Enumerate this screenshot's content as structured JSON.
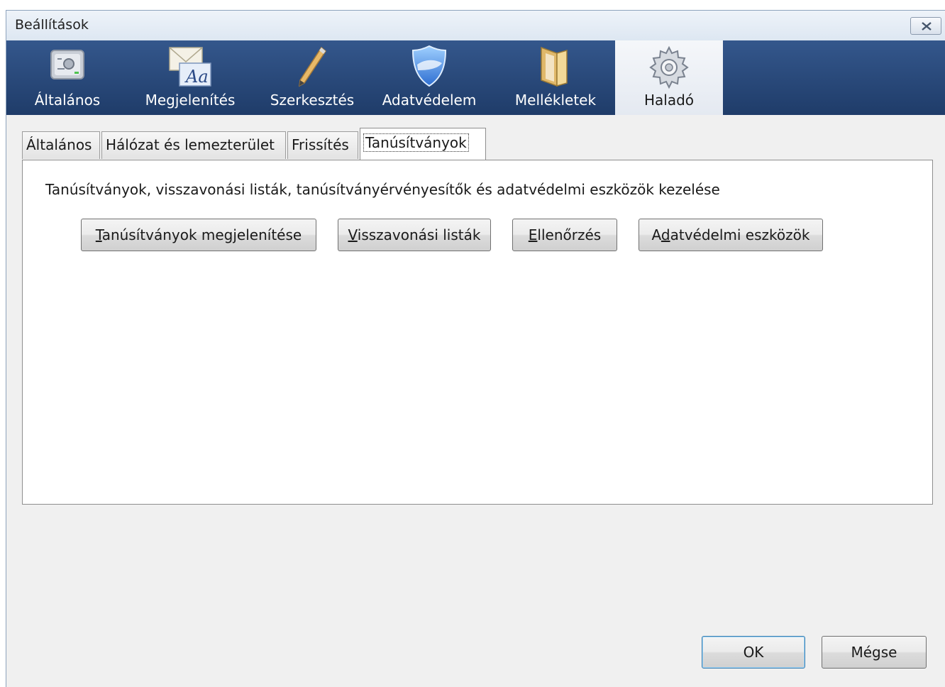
{
  "window": {
    "title": "Beállítások"
  },
  "toolbar": {
    "items": [
      {
        "label": "Általános",
        "icon": "general-icon"
      },
      {
        "label": "Megjelenítés",
        "icon": "display-icon"
      },
      {
        "label": "Szerkesztés",
        "icon": "pencil-icon"
      },
      {
        "label": "Adatvédelem",
        "icon": "shield-icon"
      },
      {
        "label": "Mellékletek",
        "icon": "folder-icon"
      },
      {
        "label": "Haladó",
        "icon": "gear-icon",
        "selected": true
      }
    ]
  },
  "tabs": [
    {
      "label": "Általános"
    },
    {
      "label": "Hálózat és lemezterület"
    },
    {
      "label": "Frissítés"
    },
    {
      "label": "Tanúsítványok",
      "active": true
    }
  ],
  "panel": {
    "description": "Tanúsítványok, visszavonási listák, tanúsítványérvényesítők és adatvédelmi eszközök kezelése",
    "buttons": [
      {
        "mnemonic": "T",
        "rest": "anúsítványok megjelenítése"
      },
      {
        "mnemonic": "V",
        "rest": "isszavonási listák"
      },
      {
        "mnemonic": "E",
        "rest": "llenőrzés"
      },
      {
        "before": "A",
        "mnemonic": "d",
        "rest": "atvédelmi eszközök"
      }
    ]
  },
  "footer": {
    "ok_label": "OK",
    "cancel_label": "Mégse"
  },
  "colors": {
    "toolbar_top": "#34578c",
    "toolbar_bottom": "#1f3c69",
    "focus_border": "#3c7fb1"
  }
}
